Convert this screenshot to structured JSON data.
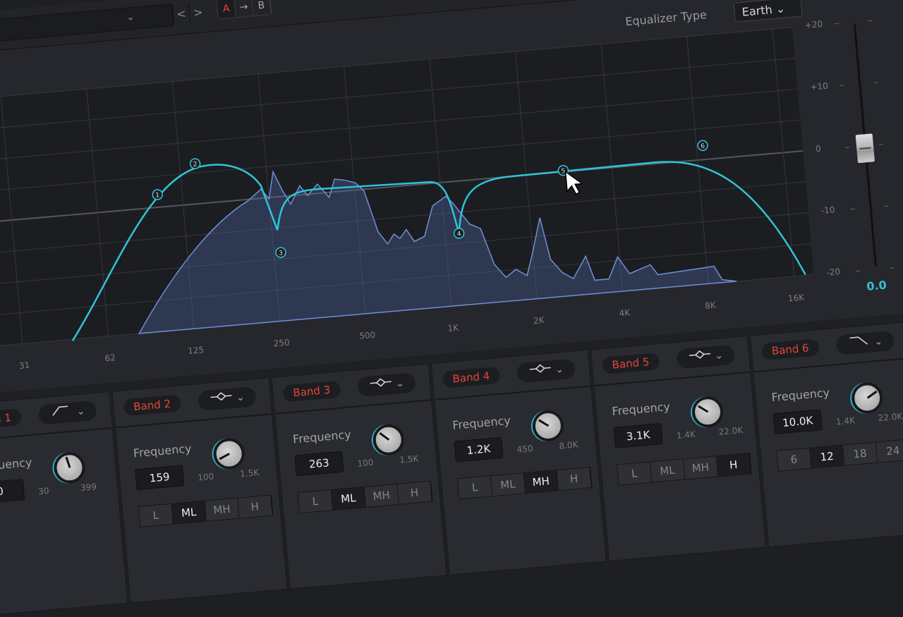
{
  "header": {
    "nav_prev": "<",
    "nav_next": ">",
    "dropdown_chevron": "⌄",
    "ab": [
      "A",
      "→",
      "B"
    ],
    "equalizer_type_label": "Equalizer Type",
    "equalizer_type_value": "Earth ⌄",
    "title": "izer"
  },
  "graph": {
    "db_labels": [
      "+20",
      "+10",
      "0",
      "-10",
      "-20"
    ],
    "freq_labels": [
      "31",
      "62",
      "125",
      "250",
      "500",
      "1K",
      "2K",
      "4K",
      "8K",
      "16K"
    ],
    "nodes": [
      "1",
      "2",
      "3",
      "4",
      "5",
      "6"
    ],
    "curve_color": "#2ec4d8",
    "spectrum_color": "#6f8fd8"
  },
  "fader": {
    "value": "0.0",
    "level": 0.5
  },
  "bands": [
    {
      "label": "Band 1",
      "type_icon": "highpass",
      "freq_label": "Frequency",
      "value": "0",
      "lo": "30",
      "hi": "399",
      "knob": 0.45,
      "buttons": []
    },
    {
      "label": "Band 2",
      "type_icon": "bell",
      "freq_label": "Frequency",
      "value": "159",
      "lo": "100",
      "hi": "1.5K",
      "knob": 0.08,
      "buttons": [
        "L",
        "ML",
        "MH",
        "H"
      ],
      "selected": "ML"
    },
    {
      "label": "Band 3",
      "type_icon": "bell",
      "freq_label": "Frequency",
      "value": "263",
      "lo": "100",
      "hi": "1.5K",
      "knob": 0.32,
      "buttons": [
        "L",
        "ML",
        "MH",
        "H"
      ],
      "selected": "ML"
    },
    {
      "label": "Band 4",
      "type_icon": "bell",
      "freq_label": "Frequency",
      "value": "1.2K",
      "lo": "450",
      "hi": "8.0K",
      "knob": 0.3,
      "buttons": [
        "L",
        "ML",
        "MH",
        "H"
      ],
      "selected": "MH"
    },
    {
      "label": "Band 5",
      "type_icon": "bell",
      "freq_label": "Frequency",
      "value": "3.1K",
      "lo": "1.4K",
      "hi": "22.0K",
      "knob": 0.3,
      "buttons": [
        "L",
        "ML",
        "MH",
        "H"
      ],
      "selected": "H"
    },
    {
      "label": "Band 6",
      "type_icon": "lowpass",
      "freq_label": "Frequency",
      "value": "10.0K",
      "lo": "1.4K",
      "hi": "22.0K",
      "knob": 0.72,
      "buttons": [
        "6",
        "12",
        "18",
        "24"
      ],
      "selected": "12"
    }
  ]
}
